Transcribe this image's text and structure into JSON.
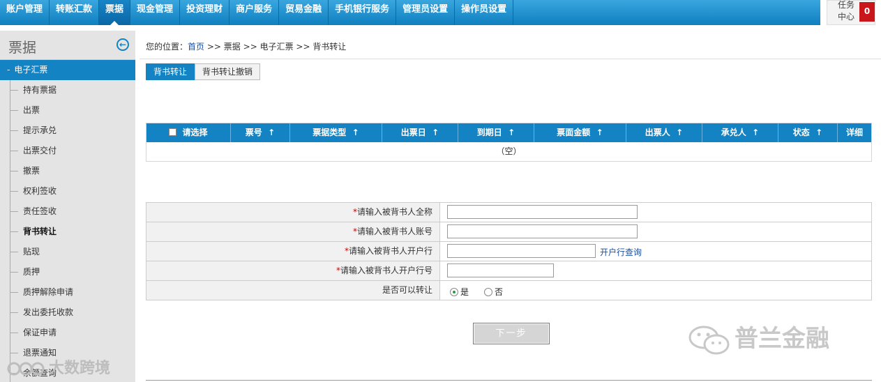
{
  "nav": {
    "items": [
      "账户管理",
      "转账汇款",
      "票据",
      "现金管理",
      "投资理财",
      "商户服务",
      "贸易金融",
      "手机银行服务",
      "管理员设置",
      "操作员设置"
    ],
    "active_index": 2,
    "task_center_label": "任务中心",
    "task_center_count": "0"
  },
  "sidebar": {
    "title": "票据",
    "group": "电子汇票",
    "items": [
      "持有票据",
      "出票",
      "提示承兑",
      "出票交付",
      "撤票",
      "权利签收",
      "责任签收",
      "背书转让",
      "贴现",
      "质押",
      "质押解除申请",
      "发出委托收款",
      "保证申请",
      "退票通知",
      "余额查询"
    ],
    "active_index": 7
  },
  "breadcrumb": {
    "prefix": "您的位置：",
    "home": "首页",
    "sep": ">>",
    "level1": "票据",
    "level2": "电子汇票",
    "level3": "背书转让"
  },
  "tabs": [
    "背书转让",
    "背书转让撤销"
  ],
  "grid": {
    "select_label": "请选择",
    "columns": [
      "票号",
      "票据类型",
      "出票日",
      "到期日",
      "票面金额",
      "出票人",
      "承兑人",
      "状态"
    ],
    "sort_glyph": "↑",
    "detail_label": "详细",
    "empty_text": "（空）"
  },
  "form": {
    "required_mark": "*",
    "name_label": "请输入被背书人全称",
    "account_label": "请输入被背书人账号",
    "bank_label": "请输入被背书人开户行",
    "bank_link": "开户行查询",
    "bank_no_label": "请输入被背书人开户行号",
    "transferable_label": "是否可以转让",
    "option_yes": "是",
    "option_no": "否",
    "selected": "是"
  },
  "next_button": "下一步",
  "watermarks": {
    "right": "普兰金融",
    "left": "大数跨境"
  }
}
